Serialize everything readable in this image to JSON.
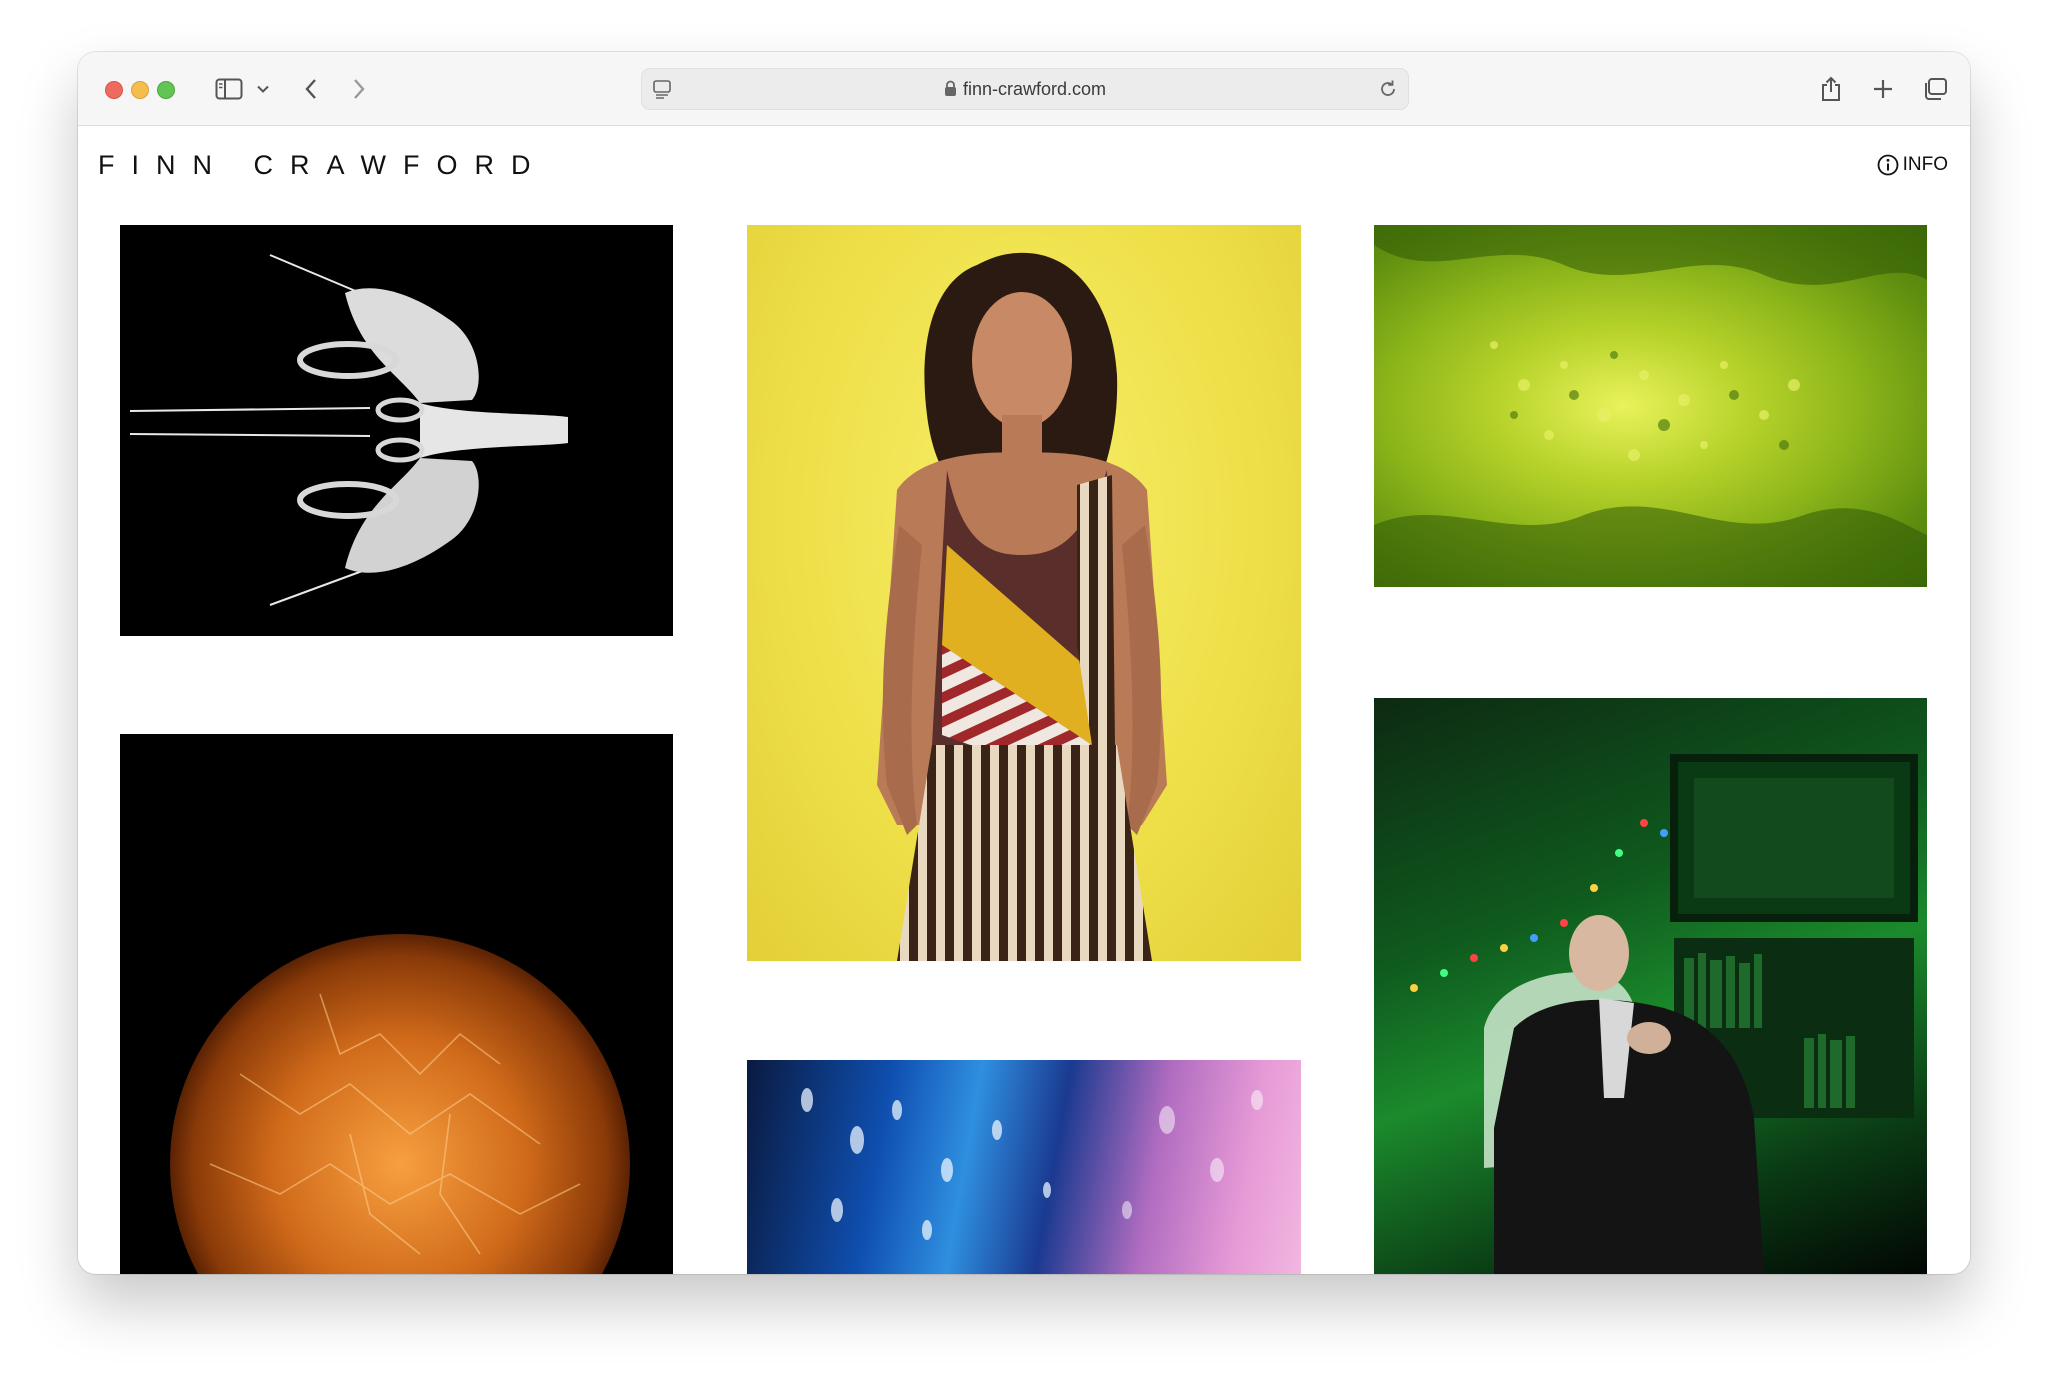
{
  "browser": {
    "url": "finn-crawford.com",
    "icons": {
      "sidebar": "sidebar-icon",
      "back": "chevron-left-icon",
      "forward": "chevron-right-icon",
      "reader": "page-menu-icon",
      "lock": "lock-icon",
      "reload": "reload-icon",
      "share": "share-icon",
      "new_tab": "plus-icon",
      "tabs": "tab-overview-icon"
    }
  },
  "site": {
    "brand": "FINN CRAWFORD",
    "info_label": "INFO"
  },
  "gallery": {
    "items": [
      {
        "subject": "white sculptural shoes on black"
      },
      {
        "subject": "model in striped dress on yellow"
      },
      {
        "subject": "green textured abstract"
      },
      {
        "subject": "orange cracked sphere on black"
      },
      {
        "subject": "blue and pink abstract"
      },
      {
        "subject": "man in suit in green lit room"
      }
    ]
  },
  "colors": {
    "traffic_red": "#ee6a5e",
    "traffic_yellow": "#f5bd4f",
    "traffic_green": "#61c454"
  }
}
